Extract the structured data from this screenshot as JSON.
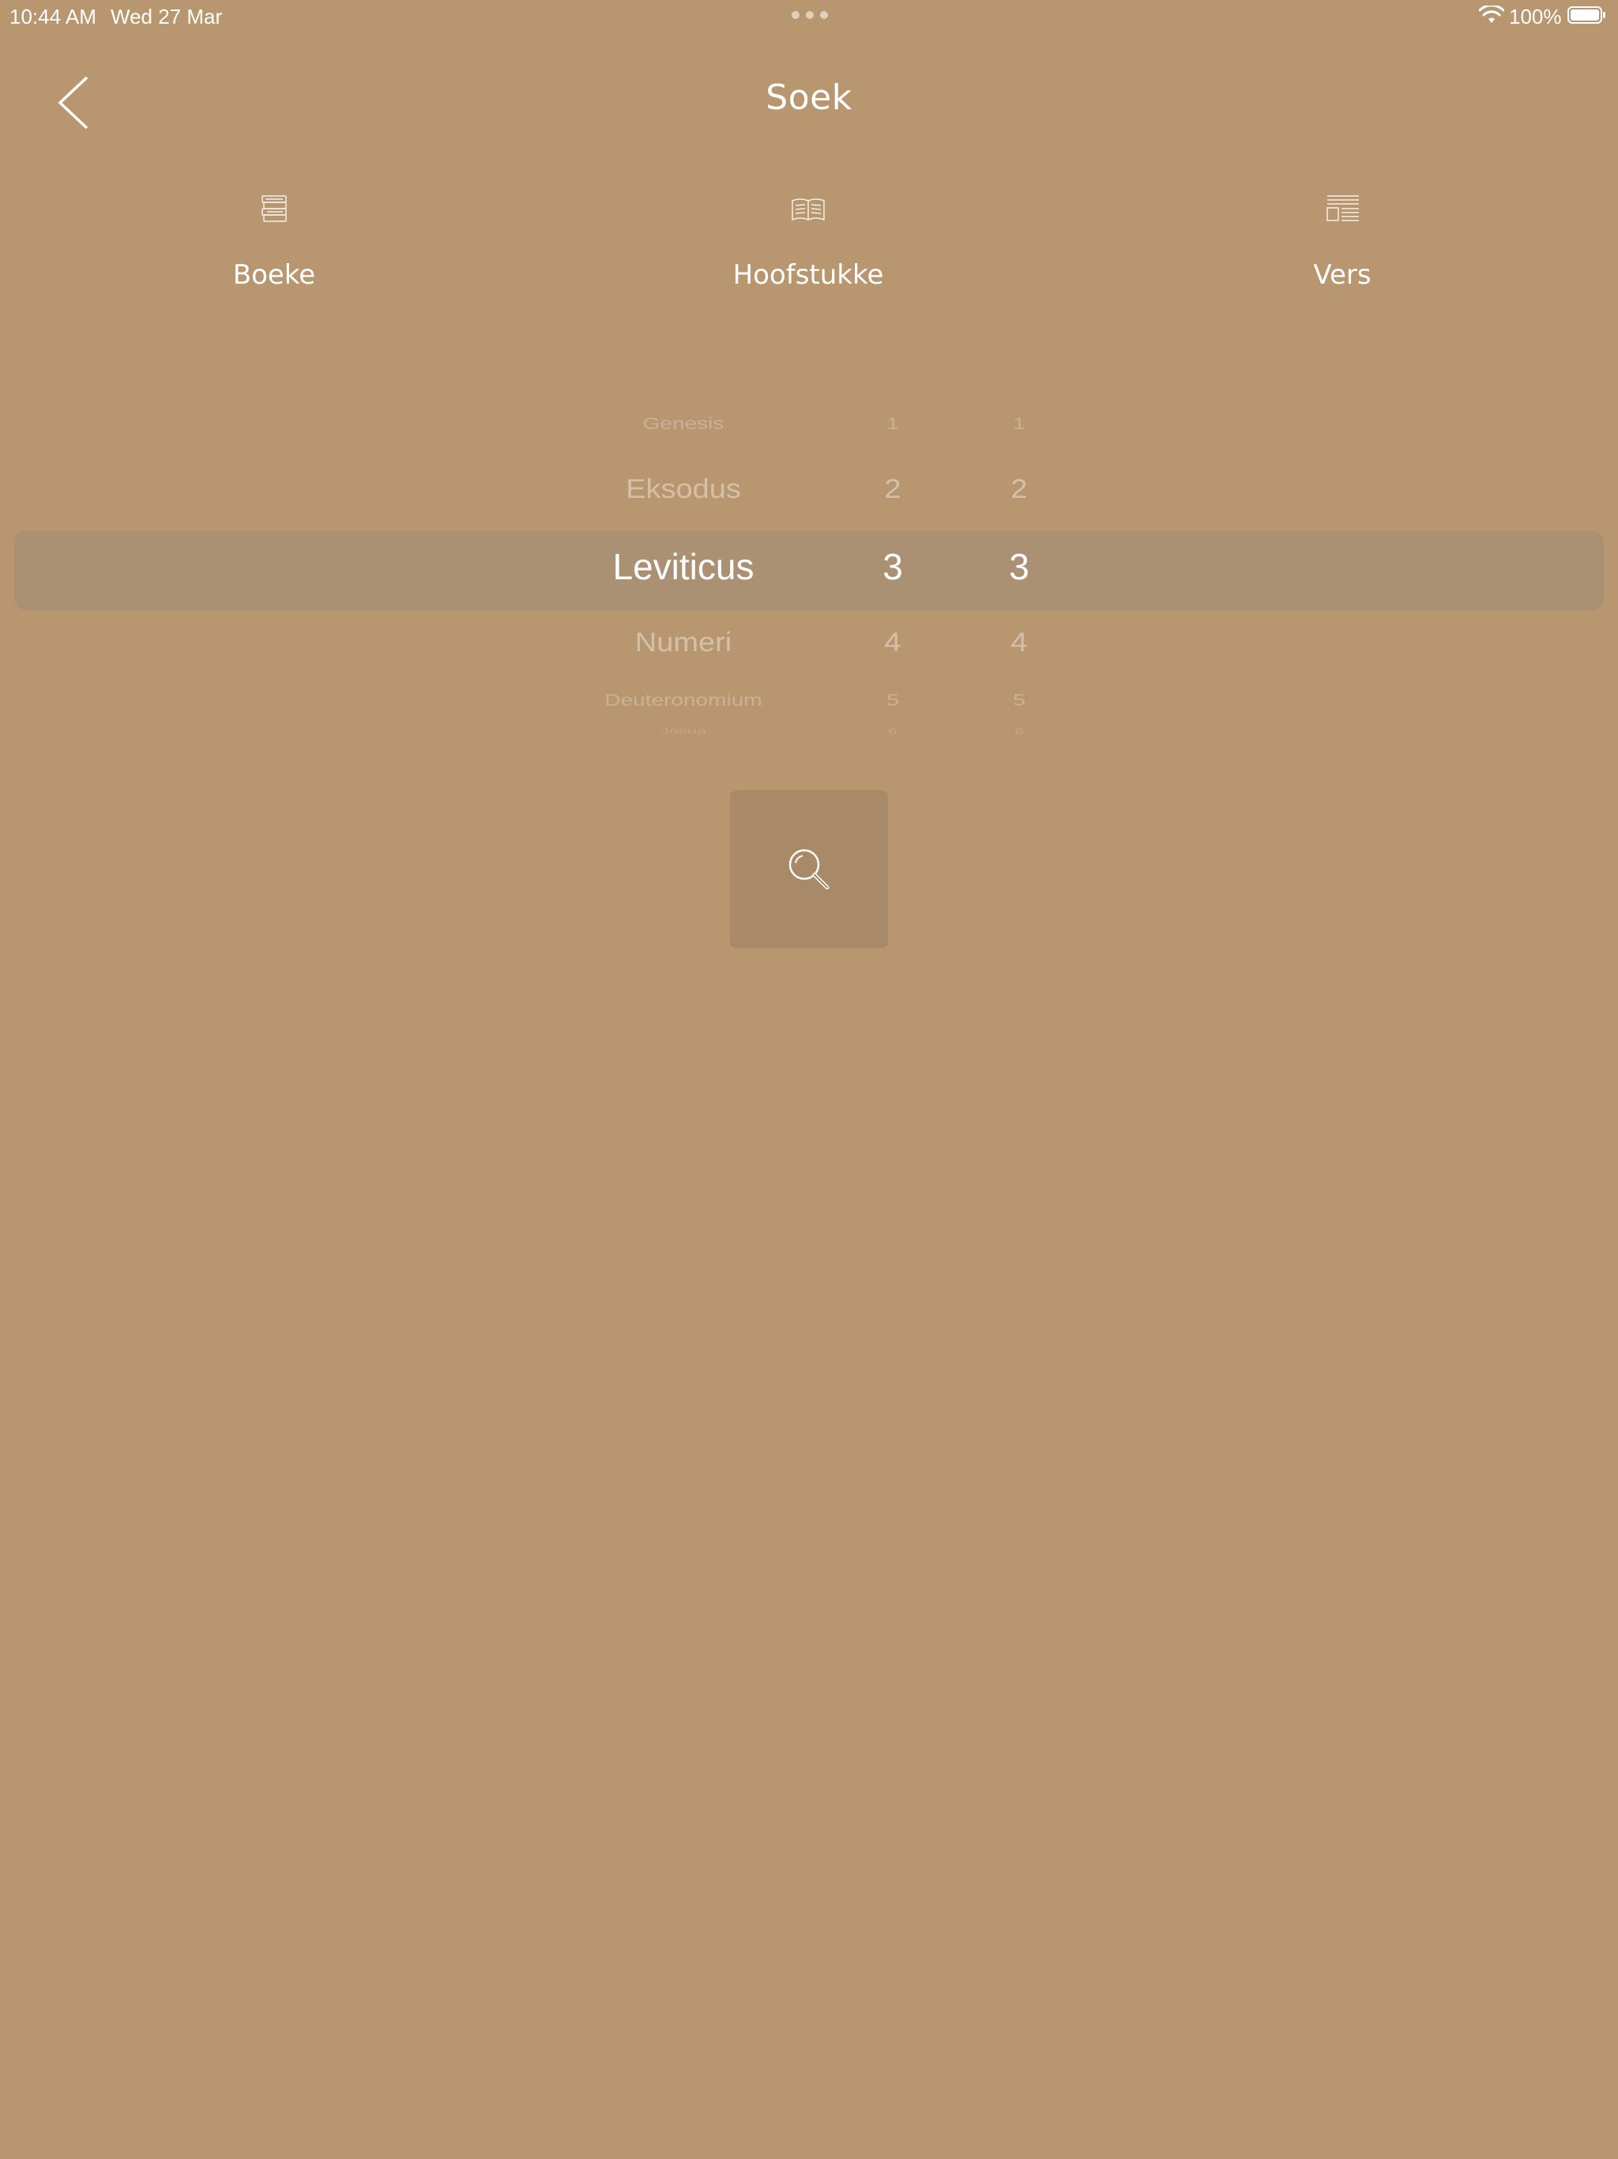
{
  "status_bar": {
    "time": "10:44 AM",
    "date": "Wed 27 Mar",
    "battery": "100%"
  },
  "nav": {
    "title": "Soek",
    "back_icon": "chevron-left-icon"
  },
  "tabs": [
    {
      "label": "Boeke",
      "icon": "books-stack-icon"
    },
    {
      "label": "Hoofstukke",
      "icon": "open-book-icon"
    },
    {
      "label": "Vers",
      "icon": "verse-text-icon"
    }
  ],
  "picker": {
    "books": [
      "Genesis",
      "Eksodus",
      "Leviticus",
      "Numeri",
      "Deuteronomium",
      "Josua"
    ],
    "chapters": [
      "1",
      "2",
      "3",
      "4",
      "5",
      "6"
    ],
    "verses": [
      "1",
      "2",
      "3",
      "4",
      "5",
      "6"
    ],
    "selected": {
      "book": "Leviticus",
      "chapter": "3",
      "verse": "3"
    }
  },
  "search_button": {
    "icon": "search-icon"
  },
  "colors": {
    "background": "#b89770",
    "highlight": "#b09478",
    "button": "#a98a68",
    "text": "#ffffff"
  }
}
